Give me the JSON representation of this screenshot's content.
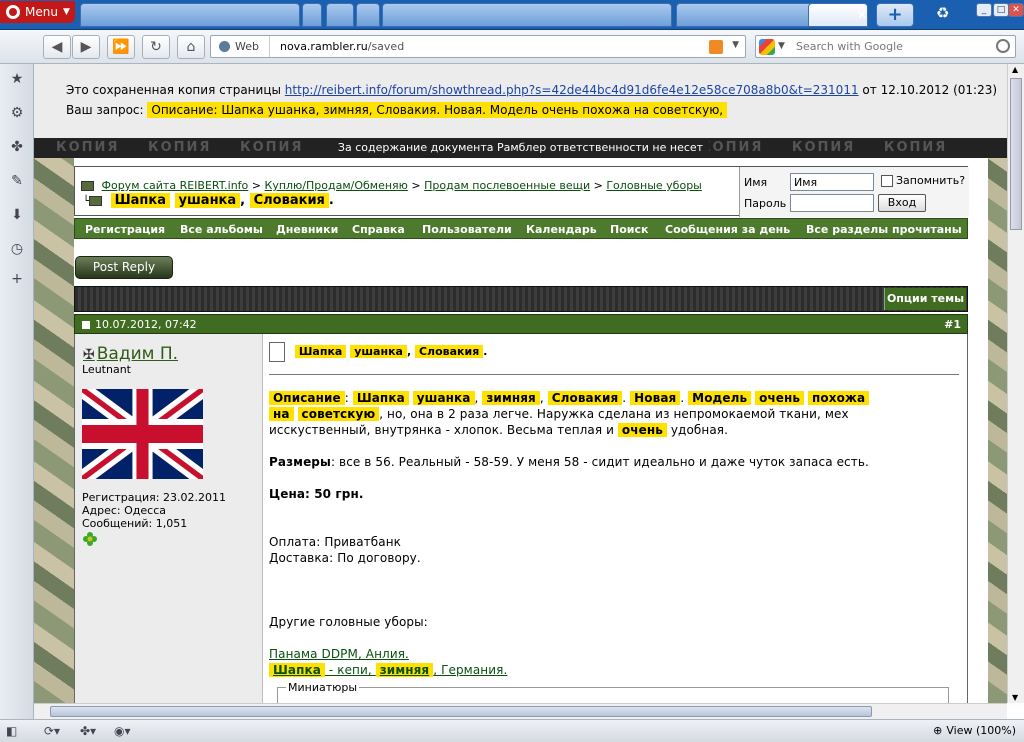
{
  "browser": {
    "menu_label": "Menu",
    "address": {
      "mode": "Web",
      "host": "nova.rambler.ru",
      "path": "/saved"
    },
    "search_placeholder": "Search with Google",
    "zoom_label": "View (100%)"
  },
  "saved": {
    "prefix": "Это сохраненная копия страницы",
    "url": "http://reibert.info/forum/showthread.php?s=42de44bc4d91d6fe4e12e58ce708a8b0&t=231011",
    "date_text": "от 12.10.2012 (01:23)",
    "query_label": "Ваш запрос:",
    "query": "Описание: Шапка ушанка, зимняя, Словакия. Новая. Модель очень похожа на советскую,",
    "banner_word": "КОПИЯ",
    "banner_msg": "За содержание документа Рамблер ответственности не несет"
  },
  "forum": {
    "breadcrumb": [
      "Форум сайта REIBERT.info",
      "Куплю/Продам/Обменяю",
      "Продам послевоенные вещи",
      "Головные уборы"
    ],
    "thread_title": [
      "Шапка",
      "ушанка",
      "Словакия"
    ],
    "login": {
      "name_label": "Имя",
      "name_value": "Имя",
      "remember_label": "Запомнить?",
      "password_label": "Пароль",
      "submit_label": "Вход"
    },
    "menu": [
      "Регистрация",
      "Все альбомы",
      "Дневники",
      "Справка",
      "Пользователи",
      "Календарь",
      "Поиск",
      "Сообщения за день",
      "Все разделы прочитаны"
    ],
    "post_reply_label": "Post Reply",
    "thread_options_label": "Опции темы"
  },
  "post": {
    "datetime": "10.07.2012, 07:42",
    "number": "#1",
    "user": {
      "name": "Вадим П.",
      "rank": "Leutnant",
      "registration": "Регистрация: 23.02.2011",
      "address": "Адрес: Одесса",
      "messages": "Сообщений: 1,051"
    },
    "title": [
      "Шапка",
      "ушанка",
      "Словакия"
    ],
    "line1_words": [
      "Описание",
      "Шапка",
      "ушанка",
      "зимняя",
      "Словакия",
      "Новая",
      "Модель",
      "очень",
      "похожа"
    ],
    "line2_words": [
      "на",
      "советскую"
    ],
    "line2_rest": ", но, она в 2 раза легче. Наружка сделана из непромокаемой ткани, мех",
    "line3_pre": "исскуственный, внутрянка - хлопок. Весьма теплая и",
    "line3_word": "очень",
    "line3_post": "удобная.",
    "sizes_label": "Размеры",
    "sizes_text": ": все в 56. Реальный - 58-59. У меня 58 - сидит идеально и даже чуток запаса есть.",
    "price": "Цена: 50 грн.",
    "payment": "Оплата: Приватбанк",
    "delivery": "Доставка: По договору.",
    "other_label": "Другие головные уборы:",
    "link1": "Панама DDPM, Анлия.",
    "link2_word1": "Шапка",
    "link2_mid": " - кепи, ",
    "link2_word2": "зимняя",
    "link2_end": ", Германия.",
    "thumbnails_label": "Миниатюры"
  }
}
